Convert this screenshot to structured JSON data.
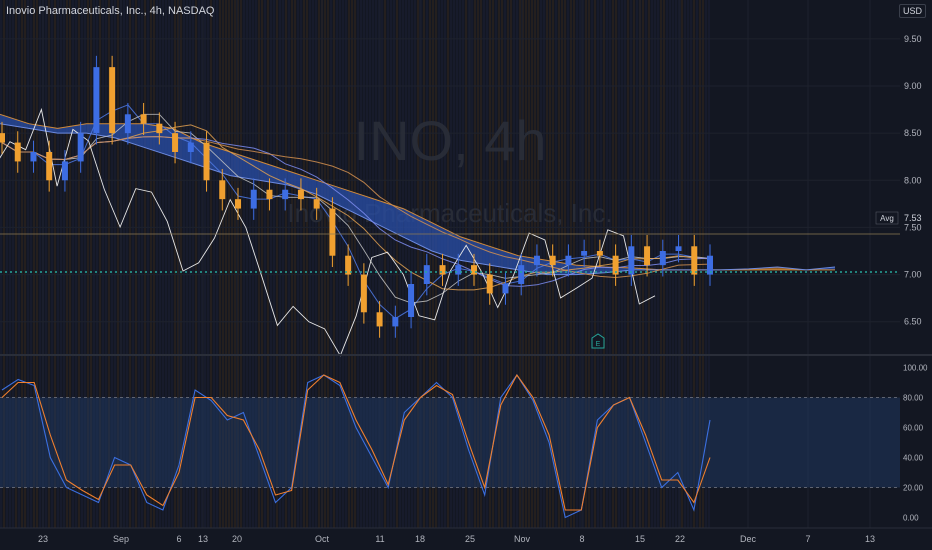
{
  "header": {
    "title": "Inovio Pharmaceuticals, Inc., 4h, NASDAQ",
    "currency": "USD"
  },
  "watermark": {
    "symbol": "INO, 4h",
    "company": "Inovio Pharmaceuticals, Inc."
  },
  "colors": {
    "background": "#131722",
    "up": "#3d6de3",
    "down": "#f0a030",
    "cloud_bull": "#2a4fa8",
    "cloud_bear": "#c2792a",
    "stoch_k": "#3b6fe0",
    "stoch_d": "#f07f2d",
    "ref_line": "#26a69a",
    "white_line": "#e6e6e6"
  },
  "price_axis": {
    "ticks": [
      "9.50",
      "9.00",
      "8.50",
      "8.00",
      "7.50",
      "7.00",
      "6.50"
    ],
    "min": 6.2,
    "max": 9.7
  },
  "avg_badge": {
    "label": "Avg",
    "value": "7.53"
  },
  "osc_axis": {
    "ticks": [
      "100.00",
      "80.00",
      "60.00",
      "40.00",
      "20.00",
      "0.00"
    ],
    "min": -5,
    "max": 105
  },
  "x_axis": {
    "ticks": [
      "23",
      "Sep",
      "6",
      "13",
      "20",
      "Oct",
      "11",
      "18",
      "25",
      "Nov",
      "8",
      "15",
      "22",
      "Dec",
      "7",
      "13"
    ]
  },
  "event_marker": "E",
  "chart_data": {
    "type": "line",
    "series": [
      {
        "values": [
          8.4,
          8.2,
          8.3,
          8.0,
          8.2,
          8.5,
          9.2,
          8.5,
          8.7,
          8.6,
          8.5,
          8.3,
          8.4,
          8.0,
          7.8,
          7.7,
          7.9,
          7.8,
          7.9,
          7.8,
          7.7,
          7.2,
          7.0,
          6.6,
          6.45,
          6.55,
          6.9,
          7.1,
          7.0,
          7.1,
          7.0,
          6.8,
          6.9,
          7.1,
          7.2,
          7.1,
          7.2,
          7.25,
          7.2,
          7.0,
          7.3,
          7.1,
          7.25,
          7.3,
          7.0,
          7.2
        ]
      },
      {
        "values": [
          8.7,
          8.6,
          8.55,
          8.6,
          8.6,
          8.6,
          8.55,
          8.4,
          8.3,
          8.2,
          8.1,
          8.0,
          7.9,
          7.8,
          7.7,
          7.55,
          7.4,
          7.3,
          7.2,
          7.15,
          7.1,
          7.08,
          7.07,
          7.05,
          7.05,
          7.05,
          7.05,
          7.05,
          7.05,
          7.05
        ]
      },
      {
        "values": [
          8.6,
          8.55,
          8.5,
          8.5,
          8.45,
          8.35,
          8.25,
          8.15,
          8.05,
          8.0,
          7.95,
          7.85,
          7.7,
          7.55,
          7.4,
          7.25,
          7.15,
          7.1,
          7.05,
          7.0,
          7.0,
          7.02,
          7.05,
          7.05,
          7.05,
          7.05,
          7.06,
          7.08,
          7.05,
          7.08
        ]
      },
      {
        "values": [
          85,
          92,
          88,
          40,
          20,
          15,
          10,
          40,
          35,
          10,
          5,
          35,
          85,
          78,
          65,
          70,
          40,
          10,
          20,
          90,
          95,
          88,
          60,
          40,
          20,
          70,
          80,
          90,
          80,
          45,
          15,
          80,
          95,
          78,
          50,
          0,
          5,
          65,
          75,
          80,
          50,
          20,
          30,
          5,
          65
        ]
      },
      {
        "values": [
          80,
          90,
          90,
          55,
          25,
          18,
          12,
          35,
          35,
          15,
          8,
          30,
          80,
          80,
          68,
          65,
          45,
          15,
          18,
          85,
          95,
          90,
          65,
          45,
          22,
          65,
          80,
          88,
          82,
          50,
          20,
          75,
          95,
          80,
          55,
          5,
          5,
          60,
          75,
          80,
          55,
          25,
          25,
          10,
          40
        ]
      }
    ],
    "ylim": [
      6.2,
      9.7
    ],
    "osc_ylim": [
      0,
      100
    ],
    "bands": [
      20,
      80
    ]
  }
}
